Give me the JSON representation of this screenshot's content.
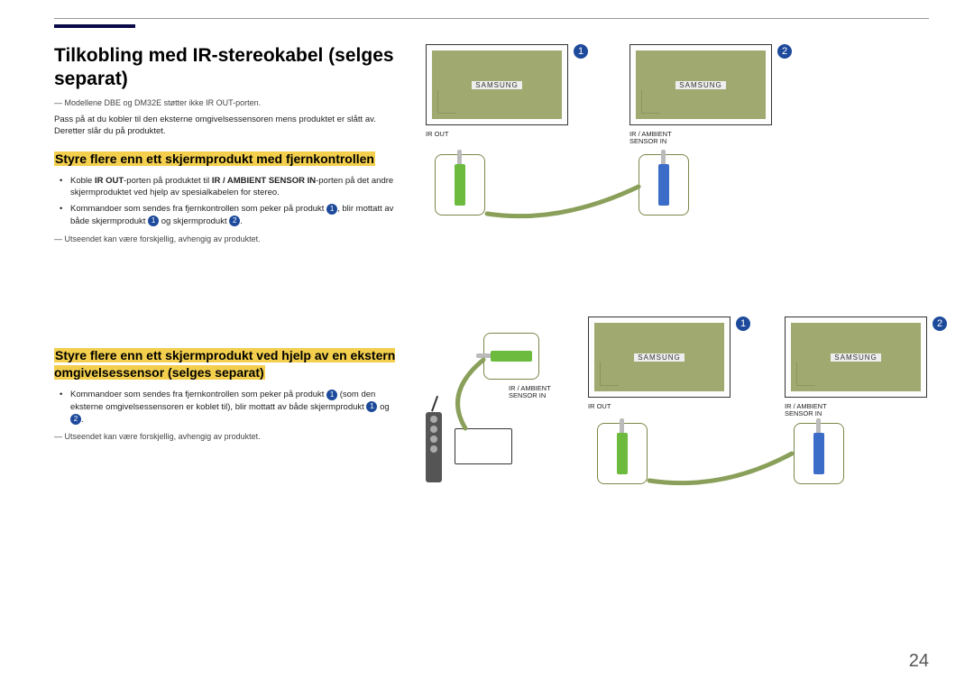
{
  "title": "Tilkobling med IR-stereokabel (selges separat)",
  "notes": {
    "modelNote": "Modellene DBE og DM32E støtter ikke IR OUT-porten.",
    "connectText": "Pass på at du kobler til den eksterne omgivelsessensoren mens produktet er slått av. Deretter slår du på produktet."
  },
  "section1": {
    "heading": "Styre flere enn ett skjermprodukt med fjernkontrollen",
    "bullet1_pre": "Koble ",
    "bullet1_bold1": "IR OUT",
    "bullet1_mid": "-porten på produktet til ",
    "bullet1_bold2": "IR / AMBIENT SENSOR IN",
    "bullet1_post": "-porten på det andre skjermproduktet ved hjelp av spesialkabelen for stereo.",
    "bullet2_pre": "Kommandoer som sendes fra fjernkontrollen som peker på produkt ",
    "bullet2_mid": ", blir mottatt av både skjermprodukt ",
    "bullet2_and": " og skjermprodukt ",
    "bullet2_end": ".",
    "appearanceNote": "Utseendet kan være forskjellig, avhengig av produktet."
  },
  "section2": {
    "heading": "Styre flere enn ett skjermprodukt ved hjelp av en ekstern omgivelsessensor (selges separat)",
    "bullet1_pre": "Kommandoer som sendes fra fjernkontrollen som peker på produkt ",
    "bullet1_mid": " (som den eksterne omgivelsessensoren er koblet til), blir mottatt av både skjermprodukt ",
    "bullet1_and": " og ",
    "bullet1_end": ".",
    "appearanceNote": "Utseendet kan være forskjellig, avhengig av produktet."
  },
  "labels": {
    "samsung": "SAMSUNG",
    "irOut": "IR OUT",
    "irAmbient": "IR / AMBIENT SENSOR IN"
  },
  "badges": {
    "one": "1",
    "two": "2"
  },
  "pageNumber": "24"
}
